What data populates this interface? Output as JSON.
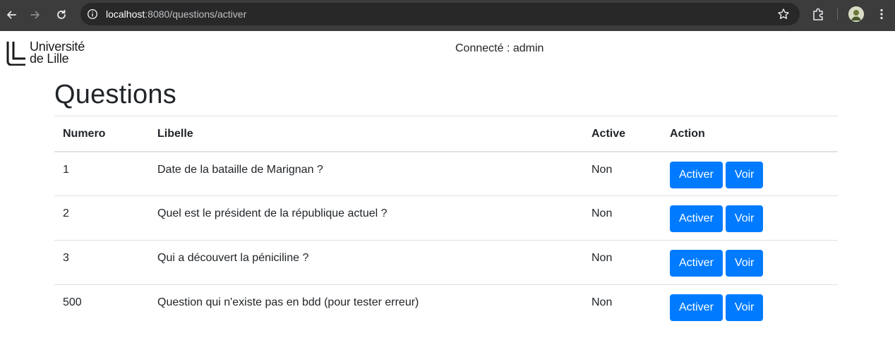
{
  "browser": {
    "url_host": "localhost",
    "url_rest": ":8080/questions/activer",
    "icons": {
      "back": "arrow-left-icon",
      "forward": "arrow-right-icon",
      "reload": "reload-icon",
      "site_info": "info-icon",
      "bookmark": "star-icon",
      "extensions": "puzzle-icon",
      "profile": "avatar",
      "menu": "kebab-menu-icon"
    }
  },
  "header": {
    "logo_line1": "Université",
    "logo_line2": "de Lille",
    "connected_text": "Connecté : admin"
  },
  "page": {
    "title": "Questions"
  },
  "table": {
    "columns": [
      "Numero",
      "Libelle",
      "Active",
      "Action"
    ],
    "rows": [
      {
        "numero": "1",
        "libelle": "Date de la bataille de Marignan ?",
        "active": "Non",
        "btn_activer": "Activer",
        "btn_voir": "Voir"
      },
      {
        "numero": "2",
        "libelle": "Quel est le président de la république actuel ?",
        "active": "Non",
        "btn_activer": "Activer",
        "btn_voir": "Voir"
      },
      {
        "numero": "3",
        "libelle": "Qui a découvert la péniciline ?",
        "active": "Non",
        "btn_activer": "Activer",
        "btn_voir": "Voir"
      },
      {
        "numero": "500",
        "libelle": "Question qui n'existe pas en bdd (pour tester erreur)",
        "active": "Non",
        "btn_activer": "Activer",
        "btn_voir": "Voir"
      }
    ]
  },
  "colors": {
    "primary_button": "#007bff",
    "chrome_bar": "#3c3c3c",
    "omnibox": "#282828",
    "text": "#212529",
    "border": "#dee2e6"
  }
}
